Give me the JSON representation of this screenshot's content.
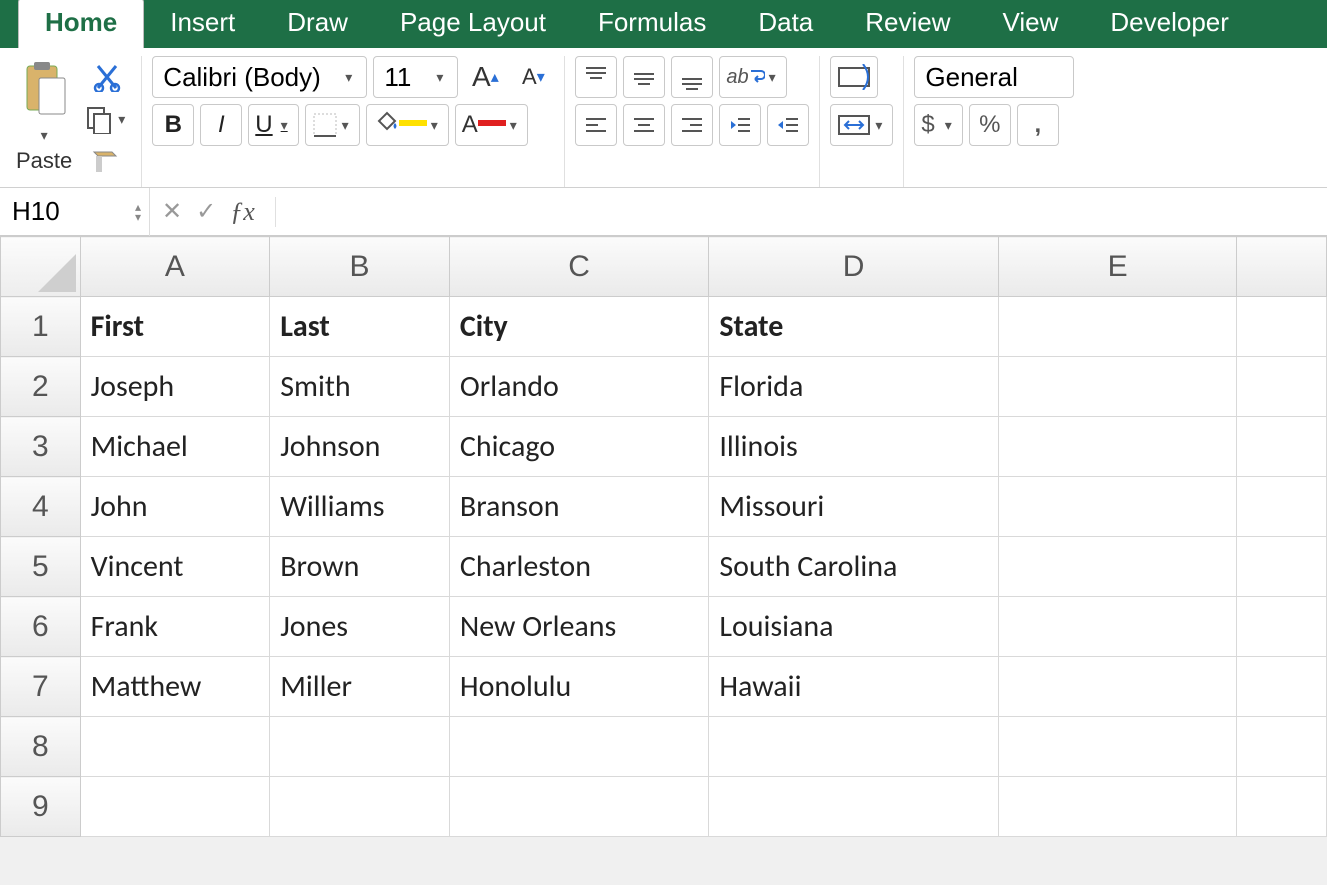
{
  "tabs": {
    "items": [
      "Home",
      "Insert",
      "Draw",
      "Page Layout",
      "Formulas",
      "Data",
      "Review",
      "View",
      "Developer"
    ],
    "active": 0
  },
  "clipboard": {
    "paste_label": "Paste"
  },
  "font": {
    "name": "Calibri (Body)",
    "size": "11"
  },
  "number": {
    "format": "General",
    "currency": "$",
    "percent": "%"
  },
  "namebox": {
    "value": "H10"
  },
  "chart_data": {
    "type": "table",
    "title": "",
    "columns": [
      "A",
      "B",
      "C",
      "D",
      "E"
    ],
    "row_numbers": [
      1,
      2,
      3,
      4,
      5,
      6,
      7,
      8,
      9
    ],
    "headers": [
      "First",
      "Last",
      "City",
      "State"
    ],
    "rows": [
      {
        "first": "Joseph",
        "last": "Smith",
        "city": "Orlando",
        "state": "Florida"
      },
      {
        "first": "Michael",
        "last": "Johnson",
        "city": "Chicago",
        "state": "Illinois"
      },
      {
        "first": "John",
        "last": "Williams",
        "city": "Branson",
        "state": "Missouri"
      },
      {
        "first": "Vincent",
        "last": "Brown",
        "city": "Charleston",
        "state": "South Carolina"
      },
      {
        "first": "Frank",
        "last": "Jones",
        "city": "New Orleans",
        "state": "Louisiana"
      },
      {
        "first": "Matthew",
        "last": "Miller",
        "city": "Honolulu",
        "state": "Hawaii"
      }
    ]
  }
}
